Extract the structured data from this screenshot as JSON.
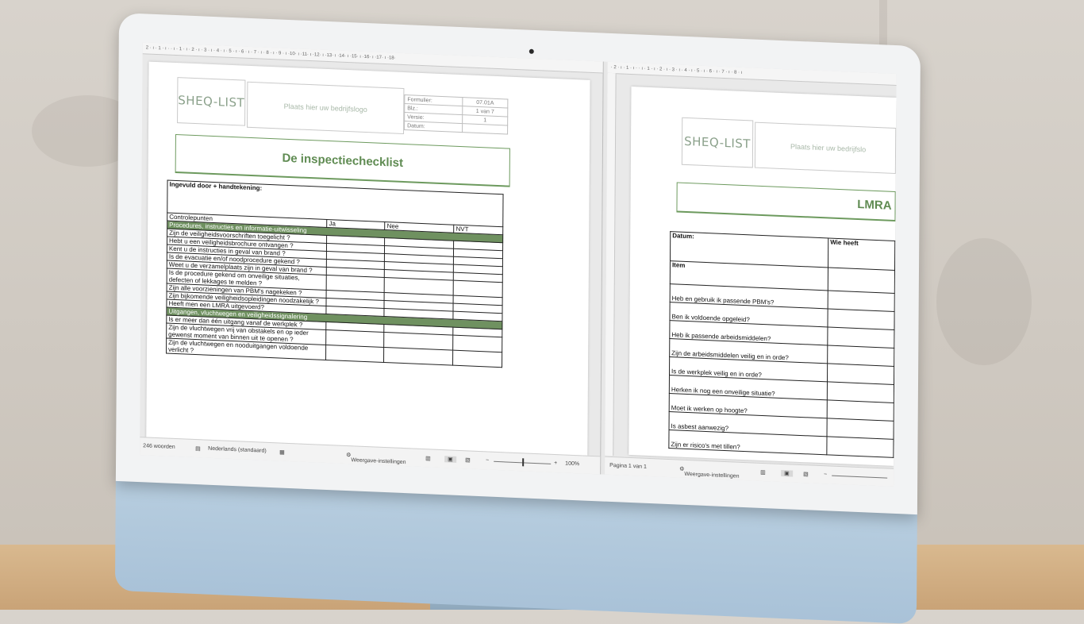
{
  "left_window": {
    "ruler_text": "2 · ı · 1 · ı · · ı · 1 · ı · 2 · ı · 3 · ı · 4 · ı · 5 · ı · 6 · ı · 7 · ı · 8 · ı · 9 · ı ·10· ı ·11· ı ·12· ı ·13· ı ·14· ı ·15· ı ·16· ı ·17· ı ·18·",
    "logo": "SHEQ-LIST",
    "logo_placeholder": "Plaats hier uw bedrijfslogo",
    "meta": [
      {
        "label": "Formulier:",
        "value": "07.01A"
      },
      {
        "label": "Blz.:",
        "value": "1 van 7"
      },
      {
        "label": "Versie:",
        "value": "1"
      },
      {
        "label": "Datum:",
        "value": ""
      }
    ],
    "title": "De inspectiechecklist",
    "filled_by": "Ingevuld door + handtekening:",
    "columns": {
      "item": "Controlepunten",
      "ja": "Ja",
      "nee": "Nee",
      "nvt": "NVT"
    },
    "section1": "Procedures, instructies en informatie-uitwisseling",
    "rows1": [
      "Zijn de veiligheidsvoorschriften toegelicht ?",
      "Hebt u een veiligheidsbrochure ontvangen ?",
      "Kent u de instructies in geval van brand ?",
      "Is de evacuatie en/of noodprocedure gekend ?",
      "Weet u de verzamelplaats zijn in geval van brand ?",
      "Is de procedure gekend om onveilige situaties, defecten of lekkages te melden ?",
      "Zijn alle voorzieningen van PBM's nagekeken ?",
      "Zijn bijkomende veiligheidsopleidingen noodzakelijk ?",
      "Heeft men een LMRA uitgevoerd?"
    ],
    "section2": "Uitgangen, vluchtwegen en veiligheidssignalering",
    "rows2": [
      "Is er meer dan één uitgang vanaf de werkplek ?",
      "Zijn de vluchtwegen vrij van obstakels en op ieder gewenst moment van binnen uit te openen ?",
      "Zijn de vluchtwegen en nooduitgangen voldoende verlicht ?"
    ],
    "status": {
      "words": "246 woorden",
      "language": "Nederlands (standaard)",
      "display_settings": "Weergave-instellingen",
      "zoom": "100%",
      "zoom_fraction": 0.5
    }
  },
  "right_window": {
    "ruler_text": "· 2 · ı · 1 · ı · · ı · 1 · ı · 2 · ı · 3 · ı · 4 · ı · 5 · ı · 6 · ı · 7 · ı · 8 · ı",
    "logo": "SHEQ-LIST",
    "logo_placeholder": "Plaats hier uw bedrijfslo",
    "title": "LMRA",
    "date_label": "Datum:",
    "who_label": "Wie heeft",
    "item_label": "Item",
    "rows": [
      "Heb en gebruik ik passende PBM's?",
      "Ben ik voldoende opgeleid?",
      "Heb ik passende arbeidsmiddelen?",
      "Zijn de arbeidsmiddelen veilig en in orde?",
      "Is de werkplek veilig en in orde?",
      "Herken ik nog een onveilige situatie?",
      "Moet ik werken op hoogte?",
      "Is asbest aanwezig?",
      "Zijn er risico's met tillen?"
    ],
    "status": {
      "page": "Pagina 1 van 1",
      "display_settings": "Weergave-instellingen"
    }
  }
}
